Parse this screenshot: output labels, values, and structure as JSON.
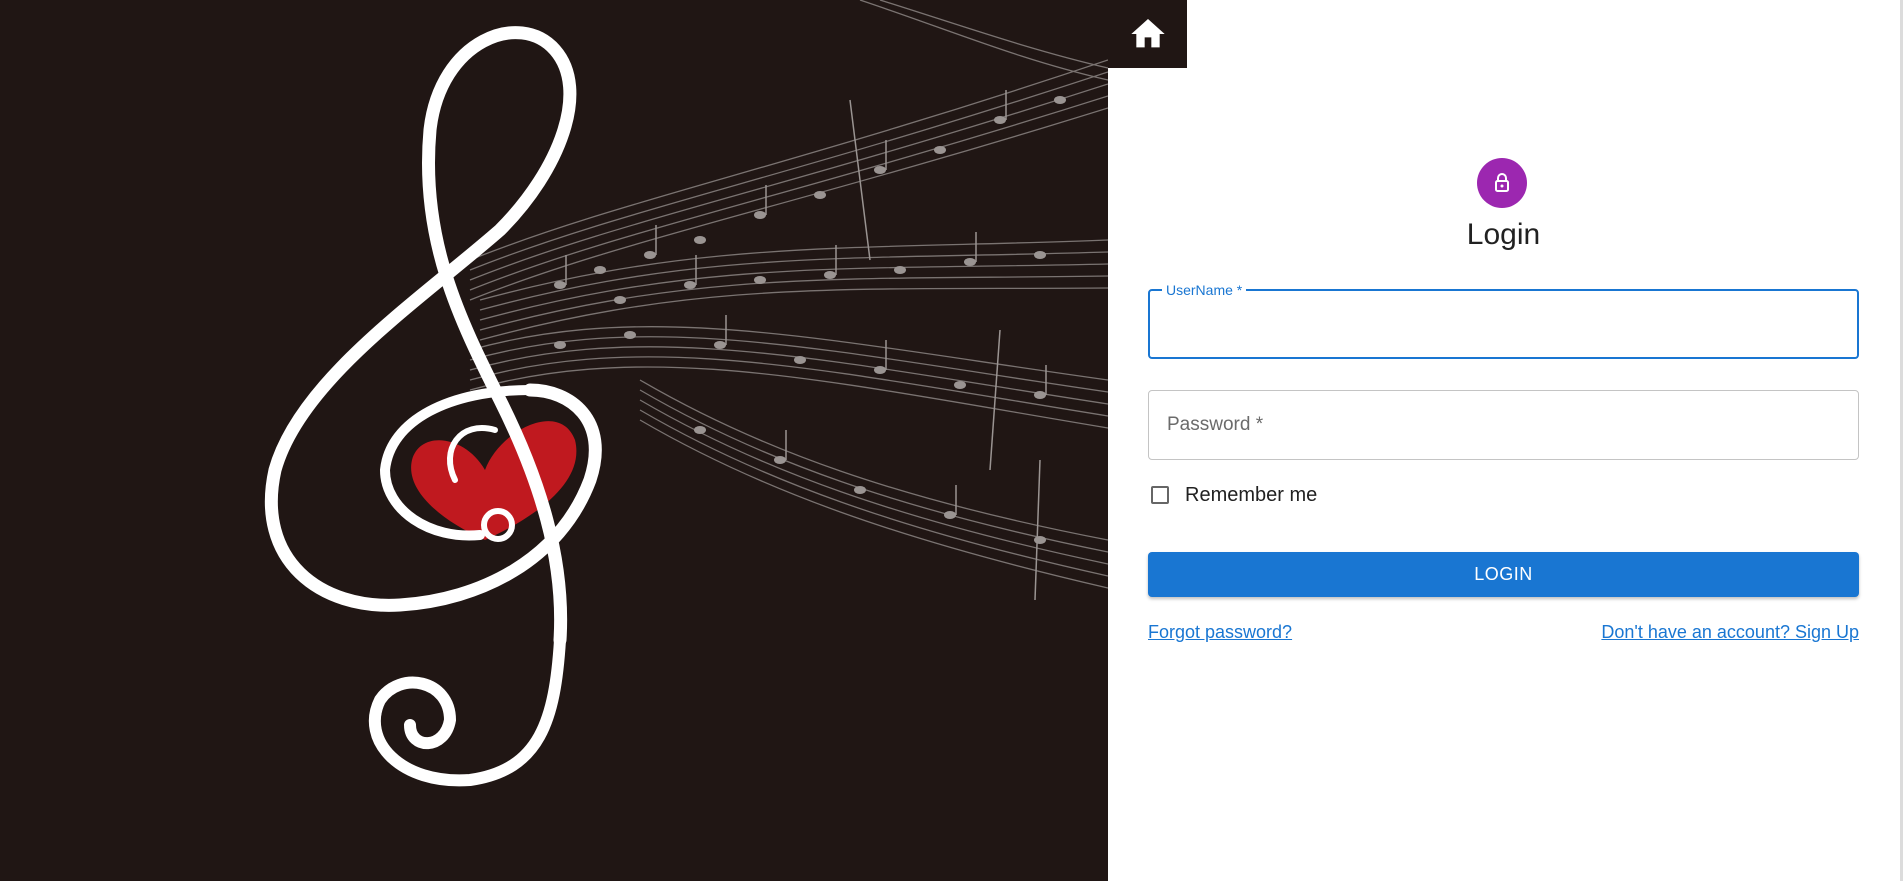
{
  "hero": {
    "image": "treble-clef-heart-music-notes",
    "colors": {
      "background": "#201614",
      "heart": "#c0191f",
      "strokes": "#ffffff"
    }
  },
  "nav": {
    "home_icon": "home-icon"
  },
  "login": {
    "avatar_icon": "lock-icon",
    "title": "Login",
    "username_label": "UserName *",
    "username_value": "",
    "password_placeholder": "Password *",
    "password_value": "",
    "remember_label": "Remember me",
    "remember_checked": false,
    "submit_label": "LOGIN",
    "forgot_link": "Forgot password?",
    "signup_link": "Don't have an account? Sign Up"
  },
  "colors": {
    "primary": "#1976d2",
    "avatar": "#9c27b0"
  }
}
